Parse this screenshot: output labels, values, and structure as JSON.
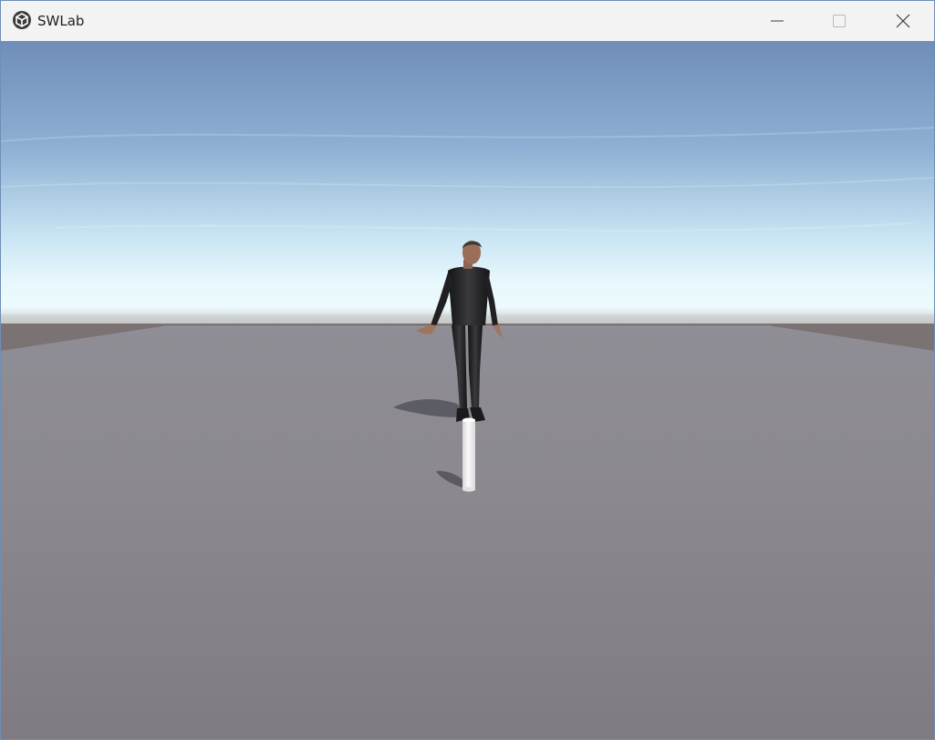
{
  "window": {
    "title": "SWLab",
    "app_icon": "unity-logo-icon",
    "controls": {
      "minimize_icon": "minimize-icon",
      "maximize_icon": "maximize-icon",
      "close_icon": "close-icon"
    }
  },
  "scene": {
    "objects": [
      "sky",
      "horizon",
      "ground-plane",
      "humanoid-character",
      "white-cylinder"
    ],
    "colors": {
      "sky_top": "#6f8db8",
      "sky_horizon": "#e8f8fd",
      "ground": "#8a868d",
      "character": "#1c1c1e",
      "cylinder": "#f4f2f2"
    }
  }
}
